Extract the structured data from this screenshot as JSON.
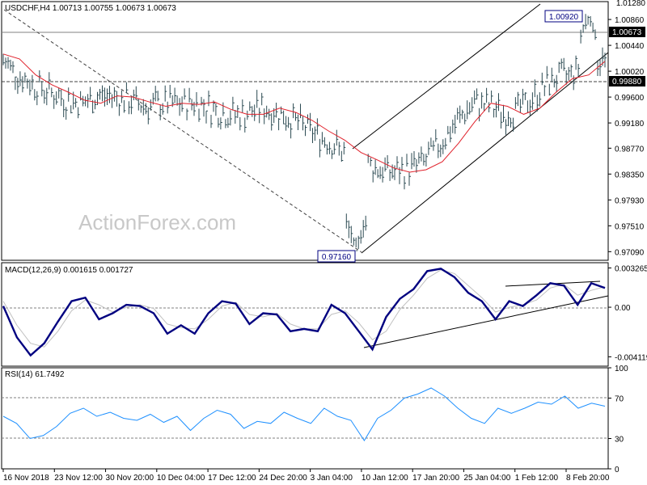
{
  "chart_data": [
    {
      "type": "bar",
      "title": "USDCHF,H4  1.00713 1.00755 1.00673 1.00673",
      "watermark": "ActionForex.com",
      "ylim": [
        0.9695,
        1.0115
      ],
      "y_ticks": [
        "1.00860",
        "1.00440",
        "1.00020",
        "0.99600",
        "0.99180",
        "0.98770",
        "0.98350",
        "0.97930",
        "0.97510",
        "0.97090"
      ],
      "y_tick_values": [
        1.0086,
        1.0044,
        1.0002,
        0.996,
        0.9918,
        0.9877,
        0.9835,
        0.9793,
        0.9751,
        0.9709
      ],
      "last_price": {
        "label": "1.00673",
        "value": 1.00673
      },
      "support_level": {
        "label": "0.99880",
        "value": 0.9988
      },
      "annotations": [
        {
          "label": "1.00920",
          "bar": 242,
          "value": 1.0092
        },
        {
          "label": "0.97160",
          "bar": 146,
          "value": 0.9716
        }
      ],
      "series": [
        {
          "name": "SMA",
          "color": "#e0202a",
          "values": [
            1.003,
            1.0022,
            0.9996,
            0.998,
            0.9968,
            0.9955,
            0.995,
            0.9962,
            0.996,
            0.9952,
            0.9945,
            0.995,
            0.9948,
            0.9952,
            0.994,
            0.9932,
            0.9932,
            0.9942,
            0.9935,
            0.9922,
            0.9905,
            0.989,
            0.987,
            0.9858,
            0.9845,
            0.9838,
            0.9842,
            0.9855,
            0.9885,
            0.992,
            0.995,
            0.9945,
            0.9932,
            0.9942,
            0.9968,
            0.999,
            0.9996,
            1.0018
          ]
        }
      ]
    },
    {
      "type": "line",
      "title": "MACD(12,26,9) 0.001615 0.001727",
      "ylim": [
        -0.0049,
        0.0037
      ],
      "y_ticks": [
        "0.003265",
        "0.00",
        "-0.004119"
      ],
      "y_tick_values": [
        0.003265,
        0,
        -0.004119
      ],
      "series": [
        {
          "name": "MACD",
          "color": "#000080",
          "values": [
            0.0001,
            -0.0025,
            -0.004,
            -0.003,
            -0.0012,
            0.0005,
            0.0008,
            -0.001,
            -0.0005,
            0.0002,
            0.0001,
            -0.0005,
            -0.0022,
            -0.0015,
            -0.0022,
            -0.0005,
            0.0005,
            0.0003,
            -0.0014,
            -0.0005,
            -0.0006,
            -0.002,
            -0.0018,
            -0.002,
            0.0002,
            -0.0005,
            -0.002,
            -0.0035,
            -0.0008,
            0.0007,
            0.0015,
            0.003,
            0.0032,
            0.0025,
            0.0012,
            0.0005,
            -0.001,
            0.0005,
            0.0001,
            0.001,
            0.002,
            0.0018,
            0.0002,
            0.002,
            0.0016
          ]
        },
        {
          "name": "Signal",
          "color": "#c0c0c0",
          "values": [
            0.0005,
            -0.0015,
            -0.003,
            -0.0033,
            -0.002,
            -0.0003,
            0.0006,
            0.0002,
            -0.0004,
            0.0,
            0.0002,
            -0.0001,
            -0.0014,
            -0.0017,
            -0.0018,
            -0.001,
            0.0001,
            0.0004,
            -0.0006,
            -0.0008,
            -0.0005,
            -0.0014,
            -0.0018,
            -0.0018,
            -0.0006,
            -0.0003,
            -0.0013,
            -0.0027,
            -0.002,
            -0.0002,
            0.001,
            0.0024,
            0.0031,
            0.0028,
            0.0018,
            0.0008,
            -0.0004,
            0.0,
            0.0002,
            0.0006,
            0.0016,
            0.0019,
            0.001,
            0.0014,
            0.0017
          ]
        }
      ]
    },
    {
      "type": "line",
      "title": "RSI(14) 61.7492",
      "ylim": [
        0,
        100
      ],
      "y_ticks": [
        "100",
        "70",
        "30",
        "0"
      ],
      "y_tick_values": [
        100,
        70,
        30,
        0
      ],
      "series": [
        {
          "name": "RSI",
          "color": "#1e90ff",
          "values": [
            52,
            45,
            30,
            33,
            42,
            55,
            60,
            52,
            56,
            50,
            48,
            54,
            46,
            52,
            38,
            50,
            58,
            54,
            40,
            47,
            45,
            56,
            50,
            45,
            60,
            52,
            48,
            28,
            50,
            58,
            70,
            74,
            80,
            72,
            60,
            50,
            45,
            60,
            55,
            60,
            66,
            64,
            72,
            60,
            65,
            62
          ]
        }
      ]
    }
  ],
  "x_labels": [
    "16 Nov 2018",
    "23 Nov 12:00",
    "30 Nov 20:00",
    "10 Dec 04:00",
    "17 Dec 12:00",
    "24 Dec 20:00",
    "3 Jan 04:00",
    "10 Jan 12:00",
    "17 Jan 20:00",
    "25 Jan 04:00",
    "1 Feb 12:00",
    "8 Feb 20:00"
  ]
}
